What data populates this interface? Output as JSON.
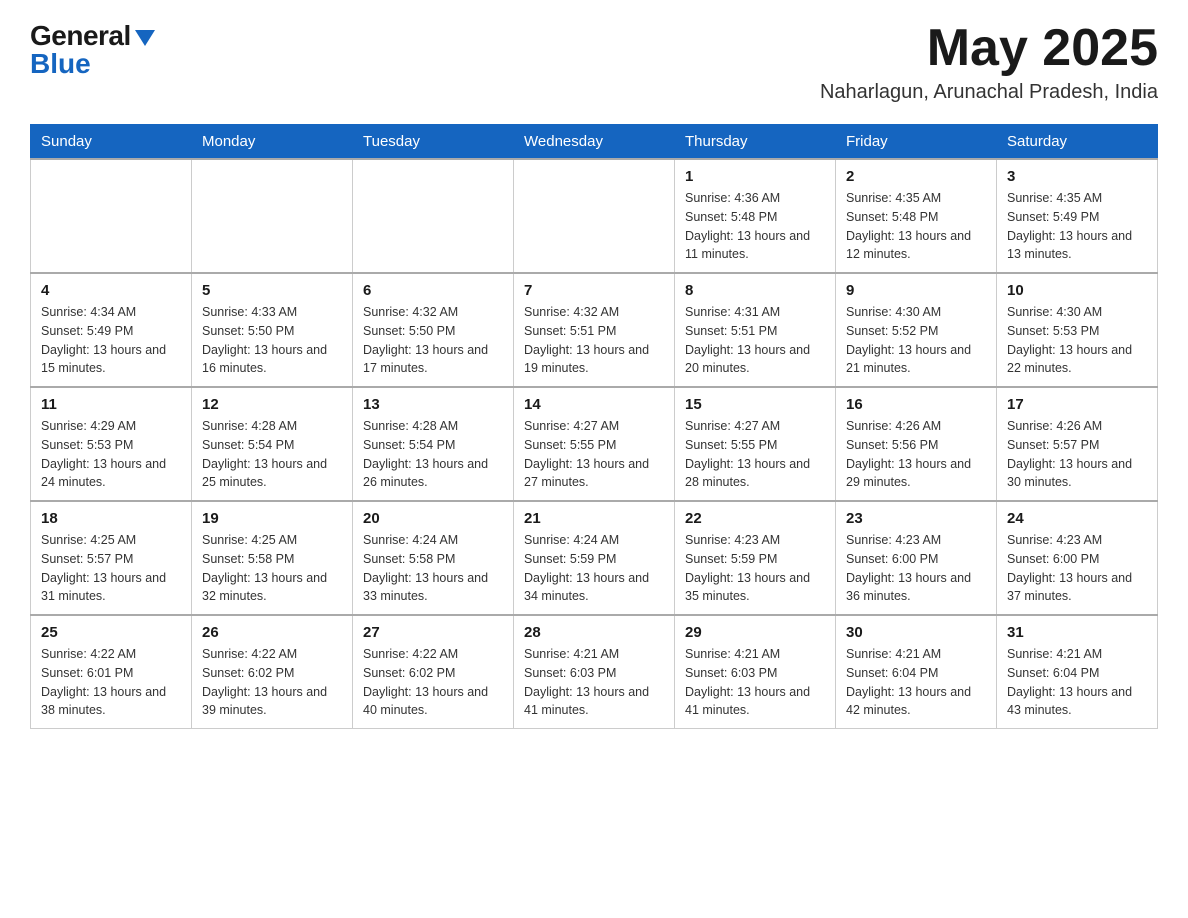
{
  "header": {
    "logo_general": "General",
    "logo_blue": "Blue",
    "month_year": "May 2025",
    "location": "Naharlagun, Arunachal Pradesh, India"
  },
  "calendar": {
    "days_of_week": [
      "Sunday",
      "Monday",
      "Tuesday",
      "Wednesday",
      "Thursday",
      "Friday",
      "Saturday"
    ],
    "weeks": [
      [
        {
          "day": "",
          "info": ""
        },
        {
          "day": "",
          "info": ""
        },
        {
          "day": "",
          "info": ""
        },
        {
          "day": "",
          "info": ""
        },
        {
          "day": "1",
          "info": "Sunrise: 4:36 AM\nSunset: 5:48 PM\nDaylight: 13 hours and 11 minutes."
        },
        {
          "day": "2",
          "info": "Sunrise: 4:35 AM\nSunset: 5:48 PM\nDaylight: 13 hours and 12 minutes."
        },
        {
          "day": "3",
          "info": "Sunrise: 4:35 AM\nSunset: 5:49 PM\nDaylight: 13 hours and 13 minutes."
        }
      ],
      [
        {
          "day": "4",
          "info": "Sunrise: 4:34 AM\nSunset: 5:49 PM\nDaylight: 13 hours and 15 minutes."
        },
        {
          "day": "5",
          "info": "Sunrise: 4:33 AM\nSunset: 5:50 PM\nDaylight: 13 hours and 16 minutes."
        },
        {
          "day": "6",
          "info": "Sunrise: 4:32 AM\nSunset: 5:50 PM\nDaylight: 13 hours and 17 minutes."
        },
        {
          "day": "7",
          "info": "Sunrise: 4:32 AM\nSunset: 5:51 PM\nDaylight: 13 hours and 19 minutes."
        },
        {
          "day": "8",
          "info": "Sunrise: 4:31 AM\nSunset: 5:51 PM\nDaylight: 13 hours and 20 minutes."
        },
        {
          "day": "9",
          "info": "Sunrise: 4:30 AM\nSunset: 5:52 PM\nDaylight: 13 hours and 21 minutes."
        },
        {
          "day": "10",
          "info": "Sunrise: 4:30 AM\nSunset: 5:53 PM\nDaylight: 13 hours and 22 minutes."
        }
      ],
      [
        {
          "day": "11",
          "info": "Sunrise: 4:29 AM\nSunset: 5:53 PM\nDaylight: 13 hours and 24 minutes."
        },
        {
          "day": "12",
          "info": "Sunrise: 4:28 AM\nSunset: 5:54 PM\nDaylight: 13 hours and 25 minutes."
        },
        {
          "day": "13",
          "info": "Sunrise: 4:28 AM\nSunset: 5:54 PM\nDaylight: 13 hours and 26 minutes."
        },
        {
          "day": "14",
          "info": "Sunrise: 4:27 AM\nSunset: 5:55 PM\nDaylight: 13 hours and 27 minutes."
        },
        {
          "day": "15",
          "info": "Sunrise: 4:27 AM\nSunset: 5:55 PM\nDaylight: 13 hours and 28 minutes."
        },
        {
          "day": "16",
          "info": "Sunrise: 4:26 AM\nSunset: 5:56 PM\nDaylight: 13 hours and 29 minutes."
        },
        {
          "day": "17",
          "info": "Sunrise: 4:26 AM\nSunset: 5:57 PM\nDaylight: 13 hours and 30 minutes."
        }
      ],
      [
        {
          "day": "18",
          "info": "Sunrise: 4:25 AM\nSunset: 5:57 PM\nDaylight: 13 hours and 31 minutes."
        },
        {
          "day": "19",
          "info": "Sunrise: 4:25 AM\nSunset: 5:58 PM\nDaylight: 13 hours and 32 minutes."
        },
        {
          "day": "20",
          "info": "Sunrise: 4:24 AM\nSunset: 5:58 PM\nDaylight: 13 hours and 33 minutes."
        },
        {
          "day": "21",
          "info": "Sunrise: 4:24 AM\nSunset: 5:59 PM\nDaylight: 13 hours and 34 minutes."
        },
        {
          "day": "22",
          "info": "Sunrise: 4:23 AM\nSunset: 5:59 PM\nDaylight: 13 hours and 35 minutes."
        },
        {
          "day": "23",
          "info": "Sunrise: 4:23 AM\nSunset: 6:00 PM\nDaylight: 13 hours and 36 minutes."
        },
        {
          "day": "24",
          "info": "Sunrise: 4:23 AM\nSunset: 6:00 PM\nDaylight: 13 hours and 37 minutes."
        }
      ],
      [
        {
          "day": "25",
          "info": "Sunrise: 4:22 AM\nSunset: 6:01 PM\nDaylight: 13 hours and 38 minutes."
        },
        {
          "day": "26",
          "info": "Sunrise: 4:22 AM\nSunset: 6:02 PM\nDaylight: 13 hours and 39 minutes."
        },
        {
          "day": "27",
          "info": "Sunrise: 4:22 AM\nSunset: 6:02 PM\nDaylight: 13 hours and 40 minutes."
        },
        {
          "day": "28",
          "info": "Sunrise: 4:21 AM\nSunset: 6:03 PM\nDaylight: 13 hours and 41 minutes."
        },
        {
          "day": "29",
          "info": "Sunrise: 4:21 AM\nSunset: 6:03 PM\nDaylight: 13 hours and 41 minutes."
        },
        {
          "day": "30",
          "info": "Sunrise: 4:21 AM\nSunset: 6:04 PM\nDaylight: 13 hours and 42 minutes."
        },
        {
          "day": "31",
          "info": "Sunrise: 4:21 AM\nSunset: 6:04 PM\nDaylight: 13 hours and 43 minutes."
        }
      ]
    ]
  }
}
